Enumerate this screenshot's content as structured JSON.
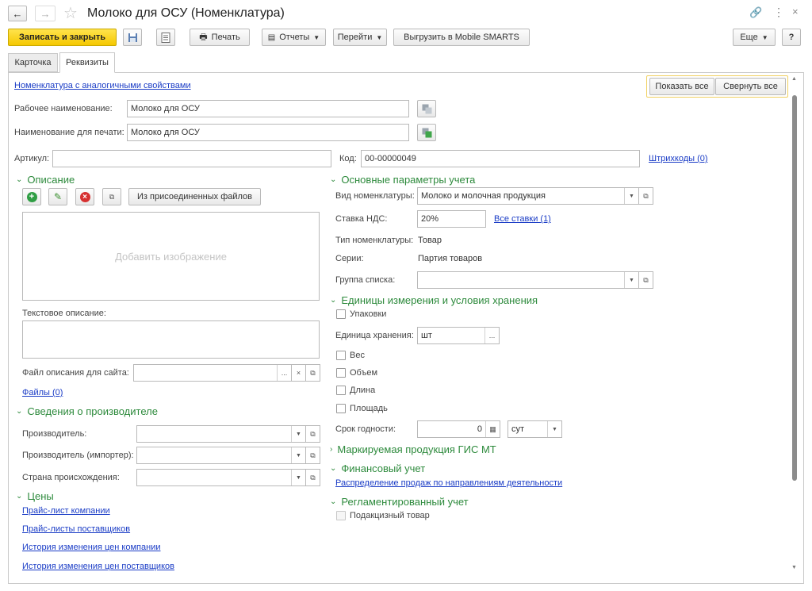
{
  "window": {
    "title": "Молоко для ОСУ (Номенклатура)"
  },
  "toolbar": {
    "save_close": "Записать и закрыть",
    "print": "Печать",
    "reports": "Отчеты",
    "goto": "Перейти",
    "export": "Выгрузить в Mobile SMARTS",
    "more": "Еще",
    "help": "?"
  },
  "tabs": [
    {
      "label": "Карточка"
    },
    {
      "label": "Реквизиты"
    }
  ],
  "header": {
    "analog_link": "Номенклатура с аналогичными свойствами",
    "show_all": "Показать все",
    "collapse_all": "Свернуть все"
  },
  "fields": {
    "work_name_label": "Рабочее наименование:",
    "work_name_value": "Молоко для ОСУ",
    "print_name_label": "Наименование для печати:",
    "print_name_value": "Молоко для ОСУ",
    "article_label": "Артикул:",
    "article_value": "",
    "code_label": "Код:",
    "code_value": "00-00000049",
    "barcodes_link": "Штрихкоды (0)"
  },
  "description": {
    "title": "Описание",
    "from_files": "Из присоединенных файлов",
    "add_image": "Добавить изображение",
    "text_desc_label": "Текстовое описание:",
    "site_file_label": "Файл описания для сайта:",
    "files_link": "Файлы (0)"
  },
  "manufacturer": {
    "title": "Сведения о производителе",
    "producer_label": "Производитель:",
    "importer_label": "Производитель (импортер):",
    "country_label": "Страна происхождения:"
  },
  "prices": {
    "title": "Цены",
    "links": [
      "Прайс-лист компании",
      "Прайс-листы поставщиков",
      "История изменения цен компании",
      "История изменения цен поставщиков"
    ]
  },
  "accounting": {
    "title": "Основные параметры учета",
    "kind_label": "Вид номенклатуры:",
    "kind_value": "Молоко и молочная продукция",
    "vat_label": "Ставка НДС:",
    "vat_value": "20%",
    "all_rates_link": "Все ставки (1)",
    "type_label": "Тип номенклатуры:",
    "type_value": "Товар",
    "series_label": "Серии:",
    "series_value": "Партия товаров",
    "group_label": "Группа списка:"
  },
  "units": {
    "title": "Единицы измерения и условия хранения",
    "packages": "Упаковки",
    "storage_unit_label": "Единица хранения:",
    "storage_unit_value": "шт",
    "weight": "Вес",
    "volume": "Объем",
    "length": "Длина",
    "area": "Площадь",
    "shelf_life_label": "Срок годности:",
    "shelf_life_value": "0",
    "shelf_life_unit": "сут"
  },
  "marking": {
    "title": "Маркируемая продукция ГИС МТ"
  },
  "finance": {
    "title": "Финансовый учет",
    "link": "Распределение продаж по направлениям деятельности"
  },
  "regulated": {
    "title": "Регламентированный учет",
    "excise": "Подакцизный товар"
  },
  "colors": {
    "accent_green": "#2d8a3c",
    "link_blue": "#1a3cc6",
    "primary_yellow": "#f5c800"
  }
}
